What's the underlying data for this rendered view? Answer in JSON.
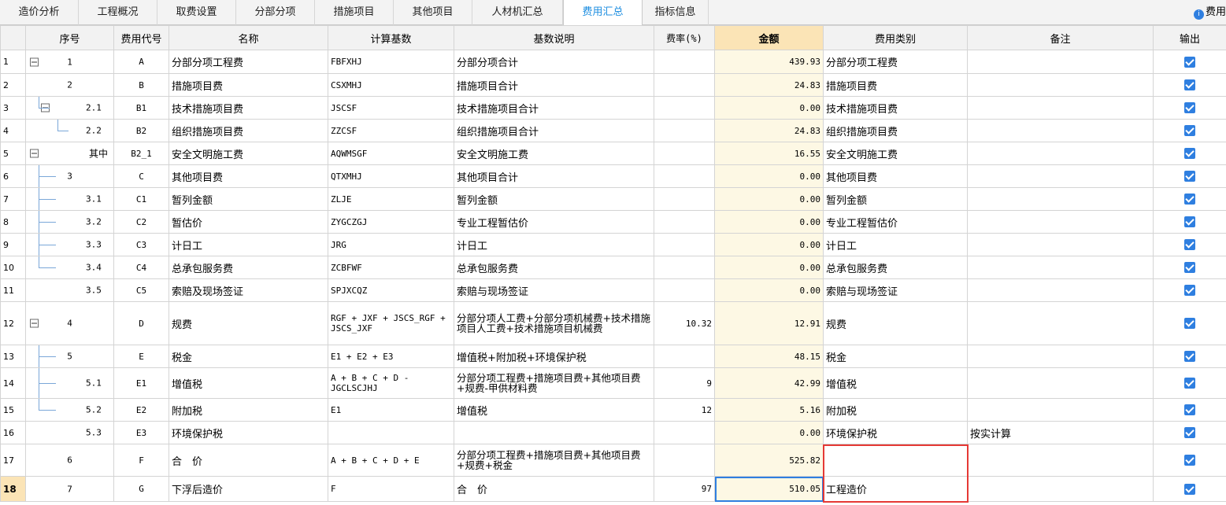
{
  "tabs": [
    {
      "label": "造价分析"
    },
    {
      "label": "工程概况"
    },
    {
      "label": "取费设置"
    },
    {
      "label": "分部分项"
    },
    {
      "label": "措施项目"
    },
    {
      "label": "其他项目"
    },
    {
      "label": "人材机汇总"
    },
    {
      "label": "费用汇总",
      "active": true
    },
    {
      "label": "指标信息"
    }
  ],
  "tab_right_label": "费用",
  "tab_right_icon": "info-circle-icon",
  "columns": {
    "rownum": "",
    "seq": "序号",
    "code": "费用代号",
    "name": "名称",
    "base": "计算基数",
    "base_desc": "基数说明",
    "rate": "费率(%)",
    "amount": "金额",
    "category": "费用类别",
    "remark": "备注",
    "output": "输出"
  },
  "rows": [
    {
      "n": "1",
      "seq": "1",
      "code": "A",
      "name": "分部分项工程费",
      "base": "FBFXHJ",
      "desc": "分部分项合计",
      "rate": "",
      "amt": "439.93",
      "cat": "分部分项工程费",
      "remark": "",
      "out": true
    },
    {
      "n": "2",
      "seq": "2",
      "code": "B",
      "name": "措施项目费",
      "base": "CSXMHJ",
      "desc": "措施项目合计",
      "rate": "",
      "amt": "24.83",
      "cat": "措施项目费",
      "remark": "",
      "out": true
    },
    {
      "n": "3",
      "seq": "2.1",
      "code": "B1",
      "name": "技术措施项目费",
      "base": "JSCSF",
      "desc": "技术措施项目合计",
      "rate": "",
      "amt": "0.00",
      "cat": "技术措施项目费",
      "remark": "",
      "out": true
    },
    {
      "n": "4",
      "seq": "2.2",
      "code": "B2",
      "name": "组织措施项目费",
      "base": "ZZCSF",
      "desc": "组织措施项目合计",
      "rate": "",
      "amt": "24.83",
      "cat": "组织措施项目费",
      "remark": "",
      "out": true
    },
    {
      "n": "5",
      "seq": "其中",
      "code": "B2_1",
      "name": "安全文明施工费",
      "base": "AQWMSGF",
      "desc": "安全文明施工费",
      "rate": "",
      "amt": "16.55",
      "cat": "安全文明施工费",
      "remark": "",
      "out": true
    },
    {
      "n": "6",
      "seq": "3",
      "code": "C",
      "name": "其他项目费",
      "base": "QTXMHJ",
      "desc": "其他项目合计",
      "rate": "",
      "amt": "0.00",
      "cat": "其他项目费",
      "remark": "",
      "out": true
    },
    {
      "n": "7",
      "seq": "3.1",
      "code": "C1",
      "name": "暂列金额",
      "base": "ZLJE",
      "desc": "暂列金额",
      "rate": "",
      "amt": "0.00",
      "cat": "暂列金额",
      "remark": "",
      "out": true
    },
    {
      "n": "8",
      "seq": "3.2",
      "code": "C2",
      "name": "暂估价",
      "base": "ZYGCZGJ",
      "desc": "专业工程暂估价",
      "rate": "",
      "amt": "0.00",
      "cat": "专业工程暂估价",
      "remark": "",
      "out": true
    },
    {
      "n": "9",
      "seq": "3.3",
      "code": "C3",
      "name": "计日工",
      "base": "JRG",
      "desc": "计日工",
      "rate": "",
      "amt": "0.00",
      "cat": "计日工",
      "remark": "",
      "out": true
    },
    {
      "n": "10",
      "seq": "3.4",
      "code": "C4",
      "name": "总承包服务费",
      "base": "ZCBFWF",
      "desc": "总承包服务费",
      "rate": "",
      "amt": "0.00",
      "cat": "总承包服务费",
      "remark": "",
      "out": true
    },
    {
      "n": "11",
      "seq": "3.5",
      "code": "C5",
      "name": "索赔及现场签证",
      "base": "SPJXCQZ",
      "desc": "索赔与现场签证",
      "rate": "",
      "amt": "0.00",
      "cat": "索赔与现场签证",
      "remark": "",
      "out": true
    },
    {
      "n": "12",
      "seq": "4",
      "code": "D",
      "name": "规费",
      "base": "RGF + JXF + JSCS_RGF + JSCS_JXF",
      "desc": "分部分项人工费+分部分项机械费+技术措施项目人工费+技术措施项目机械费",
      "rate": "10.32",
      "amt": "12.91",
      "cat": "规费",
      "remark": "",
      "out": true
    },
    {
      "n": "13",
      "seq": "5",
      "code": "E",
      "name": "税金",
      "base": "E1 + E2 + E3",
      "desc": "增值税+附加税+环境保护税",
      "rate": "",
      "amt": "48.15",
      "cat": "税金",
      "remark": "",
      "out": true
    },
    {
      "n": "14",
      "seq": "5.1",
      "code": "E1",
      "name": "增值税",
      "base": "A + B + C + D - JGCLSCJHJ",
      "desc": "分部分项工程费+措施项目费+其他项目费+规费-甲供材料费",
      "rate": "9",
      "amt": "42.99",
      "cat": "增值税",
      "remark": "",
      "out": true
    },
    {
      "n": "15",
      "seq": "5.2",
      "code": "E2",
      "name": "附加税",
      "base": "E1",
      "desc": "增值税",
      "rate": "12",
      "amt": "5.16",
      "cat": "附加税",
      "remark": "",
      "out": true
    },
    {
      "n": "16",
      "seq": "5.3",
      "code": "E3",
      "name": "环境保护税",
      "base": "",
      "desc": "",
      "rate": "",
      "amt": "0.00",
      "cat": "环境保护税",
      "remark": "按实计算",
      "out": true
    },
    {
      "n": "17",
      "seq": "6",
      "code": "F",
      "name": "合　价",
      "base": "A + B + C + D + E",
      "desc": "分部分项工程费+措施项目费+其他项目费+规费+税金",
      "rate": "",
      "amt": "525.82",
      "cat": "",
      "remark": "",
      "out": true
    },
    {
      "n": "18",
      "seq": "7",
      "code": "G",
      "name": "下浮后造价",
      "base": "F",
      "desc": "合　价",
      "rate": "97",
      "amt": "510.05",
      "cat": "工程造价",
      "remark": "",
      "out": true,
      "selected": true
    }
  ],
  "colors": {
    "accent": "#2f7fe0",
    "amount_header": "#fbe4b6",
    "amount_cell": "#fdf8e4",
    "highlight": "#e53935"
  }
}
